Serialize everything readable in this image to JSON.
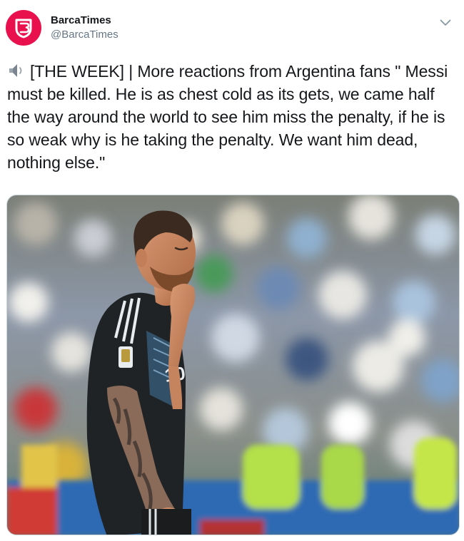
{
  "account": {
    "display_name": "BarcaTimes",
    "handle": "@BarcaTimes",
    "avatar_color": "#e8114d"
  },
  "tweet": {
    "text": "[THE WEEK] | More reactions from Argentina fans \" Messi must be killed. He is as chest cold as its gets, we came half the way around the world to see him miss the penalty, if he is so weak why is he taking the penalty. We want him dead, nothing else.\"",
    "leading_icon": "speaker-icon"
  },
  "media": {
    "type": "photo"
  },
  "icons": {
    "menu": "chevron-down-icon"
  }
}
